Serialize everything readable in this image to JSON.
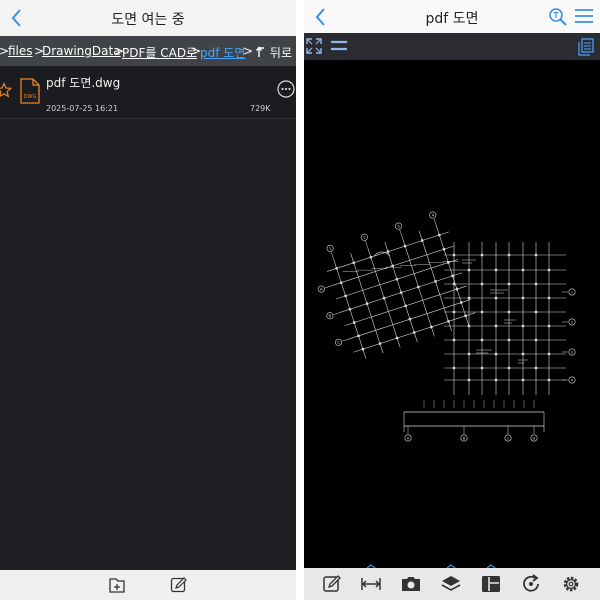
{
  "left": {
    "title": "도면 여는 중",
    "breadcrumbs": [
      "files",
      "DrawingData",
      "PDF를 CAD로",
      "pdf 도면"
    ],
    "separator": ">",
    "back_label": "뒤로",
    "file": {
      "name": "pdf 도면.dwg",
      "badge": "DWG",
      "date": "2025-07-25 16:21",
      "size": "729K"
    }
  },
  "right": {
    "title": "pdf 도면",
    "axis_labels": [
      "A",
      "B",
      "C",
      "D",
      "E",
      "F",
      "1",
      "2",
      "3",
      "4",
      "5",
      "6",
      "7"
    ]
  },
  "colors": {
    "accent": "#3d8fe0",
    "breadcrumb_current": "#4aa3ff",
    "file_icon": "#e7862a",
    "drawing_line": "#d8d8d8"
  },
  "icons": {
    "left_bottom": [
      "add-file-icon",
      "edit-icon"
    ],
    "right_bottom": [
      "markup-icon",
      "measure-icon",
      "camera-icon",
      "layers-icon",
      "layout-icon",
      "refresh-icon",
      "settings-icon"
    ]
  }
}
